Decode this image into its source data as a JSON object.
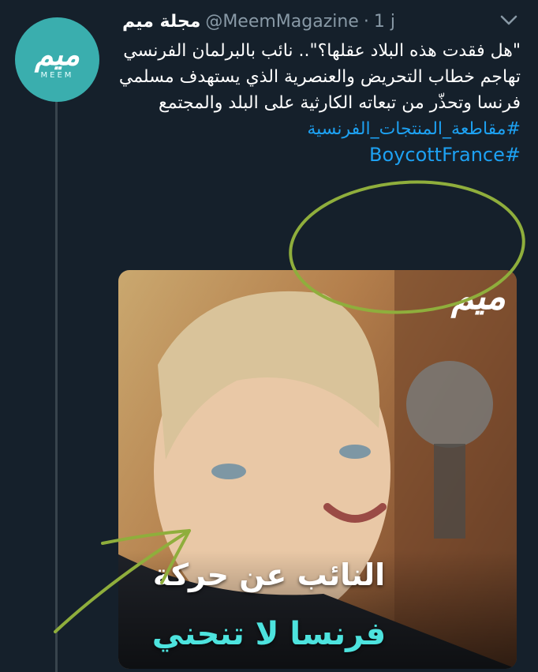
{
  "account": {
    "display_name": "مجلة ميم",
    "handle": "@MeemMagazine",
    "separator": "·",
    "time": "1 j",
    "avatar": {
      "logo_text": "ميم",
      "sub_text": "MEEM"
    }
  },
  "tweet": {
    "text": "\"هل فقدت هذه البلاد عقلها؟\".. نائب بالبرلمان الفرنسي تهاجم خطاب التحريض والعنصرية الذي يستهدف مسلمي فرنسا وتحذّر من تبعاته الكارثية على البلد والمجتمع",
    "hashtags": [
      "#مقاطعة_المنتجات_الفرنسية",
      "#BoycottFrance"
    ]
  },
  "media": {
    "logo_text": "ميم",
    "caption_line1": "النائب عن حركة",
    "caption_line2": "فرنسا لا تنحني"
  },
  "colors": {
    "background": "#15202b",
    "handle_gray": "#8899a6",
    "link_blue": "#1da1f2",
    "avatar_teal": "#3aaeae",
    "caption_teal": "#4de3de",
    "annotation_green": "#8fae3c"
  },
  "icons": [
    "chevron-down-icon"
  ]
}
